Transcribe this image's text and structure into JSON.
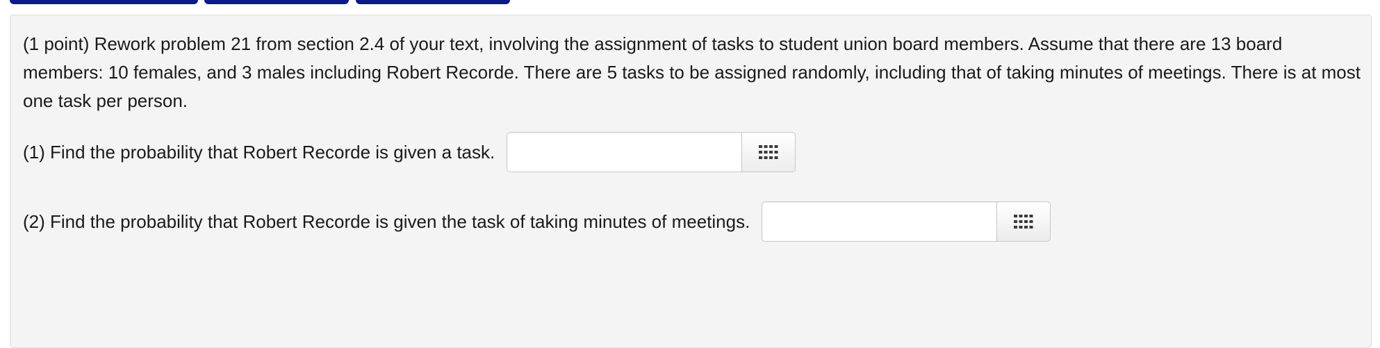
{
  "problem": {
    "statement": "(1 point) Rework problem 21 from section 2.4 of your text, involving the assignment of tasks to student union board members. Assume that there are 13 board members: 10 females, and 3 males including Robert Recorde. There are 5 tasks to be assigned randomly, including that of taking minutes of meetings. There is at most one task per person.",
    "questions": [
      {
        "text": "(1) Find the probability that Robert Recorde is given a task.",
        "answer_value": "",
        "keypad_icon": "keypad-grid-icon"
      },
      {
        "text": "(2) Find the probability that Robert Recorde is given the task of taking minutes of meetings.",
        "answer_value": "",
        "keypad_icon": "keypad-grid-icon"
      }
    ]
  },
  "colors": {
    "top_tab": "#0c1a8c",
    "panel_background": "#f4f4f4",
    "keypad_icon": "#3a3a3a"
  }
}
